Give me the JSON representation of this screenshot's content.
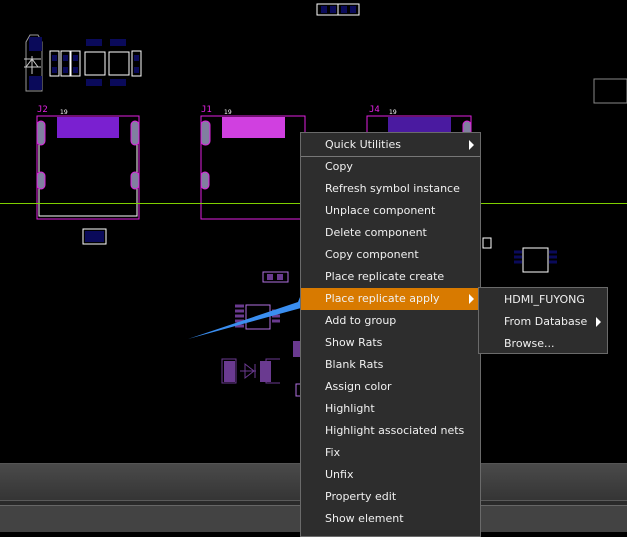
{
  "canvas": {
    "refdes": [
      "J2",
      "J1",
      "J4"
    ],
    "pin_labels": [
      "19",
      "19",
      "19"
    ]
  },
  "context_menu": {
    "items": [
      {
        "label": "Quick Utilities",
        "submenu": true
      },
      {
        "label": "Copy"
      },
      {
        "label": "Refresh symbol instance"
      },
      {
        "label": "Unplace component"
      },
      {
        "label": "Delete component"
      },
      {
        "label": "Copy component"
      },
      {
        "label": "Place replicate create"
      },
      {
        "label": "Place replicate apply",
        "submenu": true,
        "active": true
      },
      {
        "label": "Add to group"
      },
      {
        "label": "Show Rats"
      },
      {
        "label": "Blank Rats"
      },
      {
        "label": "Assign color"
      },
      {
        "label": "Highlight"
      },
      {
        "label": "Highlight associated nets"
      },
      {
        "label": "Fix"
      },
      {
        "label": "Unfix"
      },
      {
        "label": "Property edit"
      },
      {
        "label": "Show element"
      }
    ]
  },
  "submenu": {
    "items": [
      {
        "label": "HDMI_FUYONG"
      },
      {
        "label": "From Database",
        "submenu": true
      },
      {
        "label": "Browse..."
      }
    ]
  },
  "colors": {
    "highlight": "#d87a00",
    "annotation_arrow": "#3a8ef0",
    "ratsnest": "#7fd000"
  }
}
